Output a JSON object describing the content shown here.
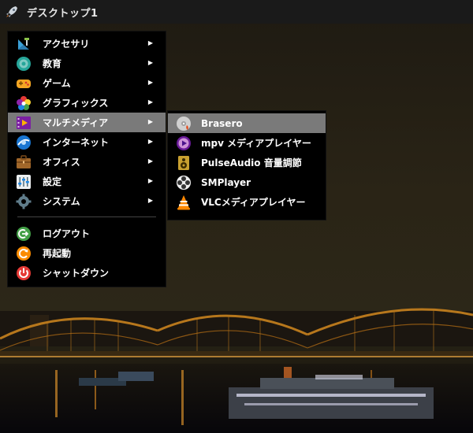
{
  "topbar": {
    "title": "デスクトップ1",
    "launcher_icon": "rocket-icon"
  },
  "main_menu": {
    "items": [
      {
        "label": "アクセサリ",
        "icon": "accessories-icon",
        "has_submenu": true
      },
      {
        "label": "教育",
        "icon": "education-icon",
        "has_submenu": true
      },
      {
        "label": "ゲーム",
        "icon": "gamepad-icon",
        "has_submenu": true
      },
      {
        "label": "グラフィックス",
        "icon": "graphics-icon",
        "has_submenu": true
      },
      {
        "label": "マルチメディア",
        "icon": "multimedia-icon",
        "has_submenu": true,
        "active": true
      },
      {
        "label": "インターネット",
        "icon": "internet-icon",
        "has_submenu": true
      },
      {
        "label": "オフィス",
        "icon": "office-icon",
        "has_submenu": true
      },
      {
        "label": "設定",
        "icon": "settings-icon",
        "has_submenu": true
      },
      {
        "label": "システム",
        "icon": "system-icon",
        "has_submenu": true
      }
    ],
    "session_items": [
      {
        "label": "ログアウト",
        "icon": "logout-icon"
      },
      {
        "label": "再起動",
        "icon": "restart-icon"
      },
      {
        "label": "シャットダウン",
        "icon": "shutdown-icon"
      }
    ],
    "submenu_arrow": "▶"
  },
  "sub_menu": {
    "items": [
      {
        "label": "Brasero",
        "icon": "brasero-icon",
        "active": true
      },
      {
        "label": "mpv メディアプレイヤー",
        "icon": "mpv-icon"
      },
      {
        "label": "PulseAudio 音量調節",
        "icon": "speaker-icon"
      },
      {
        "label": "SMPlayer",
        "icon": "smplayer-icon"
      },
      {
        "label": "VLCメディアプレイヤー",
        "icon": "vlc-icon"
      }
    ]
  },
  "colors": {
    "menu_bg": "#000000",
    "highlight": "#7a7a7a",
    "topbar": "#1a1a1a"
  }
}
